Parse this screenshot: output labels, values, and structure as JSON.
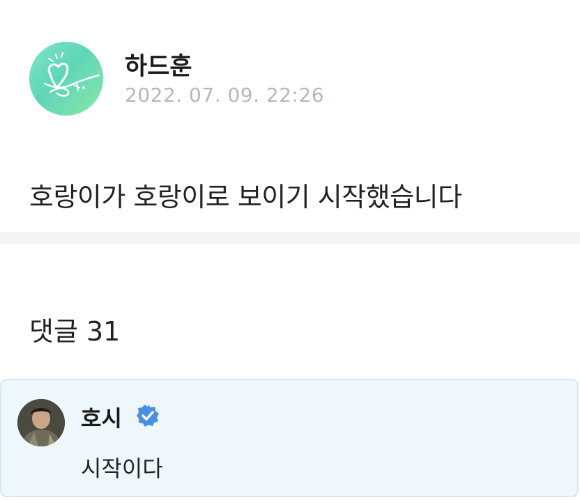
{
  "post": {
    "author": "하드훈",
    "timestamp": "2022. 07. 09. 22:26",
    "body": "호랑이가 호랑이로 보이기 시작했습니다",
    "avatar_icon": "heart-doodle-avatar",
    "avatar_colors": [
      "#7fe3cc",
      "#8ae6a6"
    ]
  },
  "comments": {
    "header": "댓글 31",
    "items": [
      {
        "author": "호시",
        "verified": true,
        "verified_icon": "verified-check-icon",
        "verified_color": "#4a90e2",
        "text": "시작이다",
        "avatar_icon": "profile-photo-avatar",
        "highlight_color": "#eef7fb"
      }
    ]
  }
}
